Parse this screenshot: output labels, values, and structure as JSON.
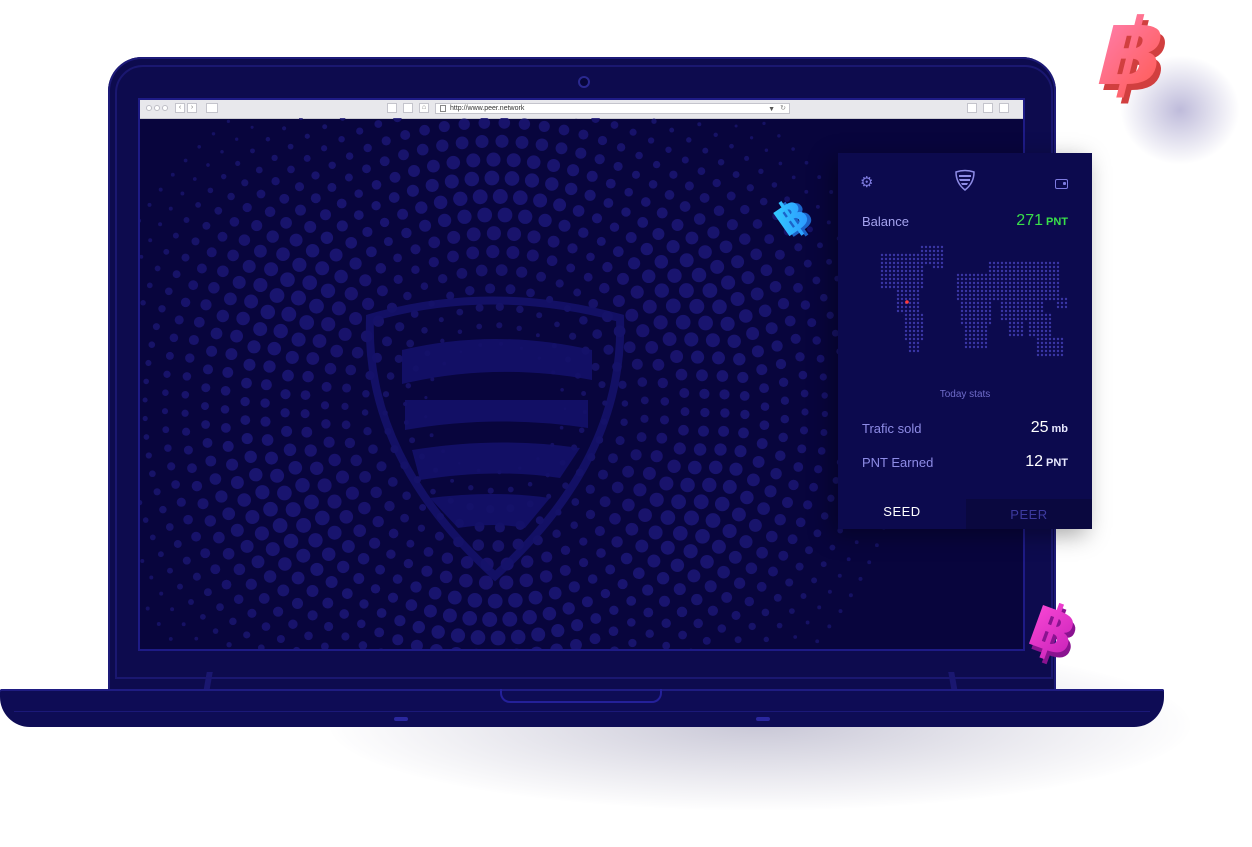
{
  "browser": {
    "url": "http://www.peer.network"
  },
  "panel": {
    "balance_label": "Balance",
    "balance_value": "271",
    "balance_unit": "PNT",
    "today_stats_label": "Today stats",
    "stats": [
      {
        "label": "Trafic sold",
        "value": "25",
        "unit": "mb"
      },
      {
        "label": "PNT Earned",
        "value": "12",
        "unit": "PNT"
      }
    ],
    "tabs": {
      "seed": "SEED",
      "peer": "PEER"
    }
  },
  "icons": {
    "settings": "gear-icon",
    "brand": "shield-logo-icon",
    "wallet": "wallet-icon",
    "coins": [
      "bitcoin-coin-icon",
      "bitcoin-coin-icon",
      "bitcoin-coin-icon"
    ]
  },
  "colors": {
    "screen_bg": "#08053d",
    "panel_bg": "#0c0a4e",
    "balance_green": "#39e04a",
    "accent_purple": "#7e7be0"
  }
}
